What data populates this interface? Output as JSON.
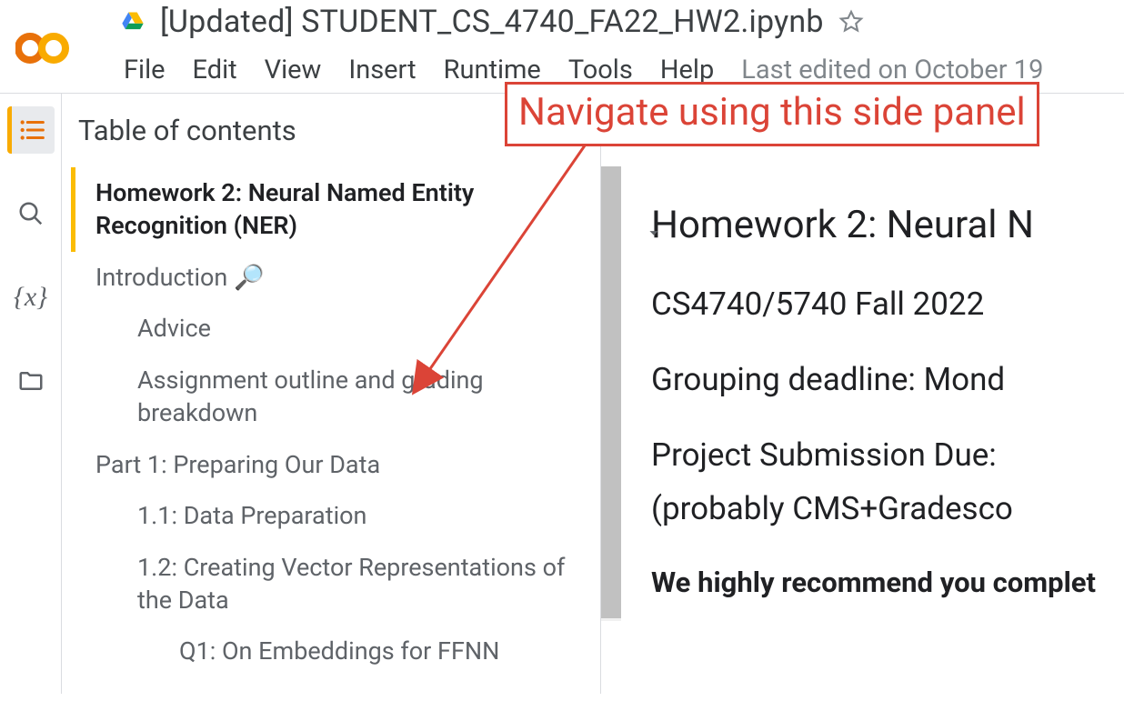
{
  "header": {
    "title": "[Updated] STUDENT_CS_4740_FA22_HW2.ipynb",
    "menu": [
      "File",
      "Edit",
      "View",
      "Insert",
      "Runtime",
      "Tools",
      "Help"
    ],
    "last_edited": "Last edited on October 19"
  },
  "toc": {
    "title": "Table of contents",
    "items": [
      {
        "label": "Homework 2: Neural Named Entity Recognition (NER)",
        "indent": 1,
        "active": true
      },
      {
        "label": "Introduction 🔎",
        "indent": 1
      },
      {
        "label": "Advice",
        "indent": 2
      },
      {
        "label": "Assignment outline and grading breakdown",
        "indent": 2
      },
      {
        "label": "Part 1: Preparing Our Data",
        "indent": 1
      },
      {
        "label": "1.1: Data Preparation",
        "indent": 2
      },
      {
        "label": "1.2: Creating Vector Representations of the Data",
        "indent": 2
      },
      {
        "label": "Q1: On Embeddings for FFNN",
        "indent": 3
      }
    ]
  },
  "notebook": {
    "heading": "Homework 2: Neural N",
    "line1": "CS4740/5740 Fall 2022",
    "line2": "Grouping deadline: Mond",
    "line3": "Project Submission Due:",
    "line4": "(probably CMS+Gradesco",
    "bold": "We highly recommend you complet"
  },
  "annotation": {
    "text": "Navigate using this side panel"
  },
  "colors": {
    "accent_orange": "#e8710a",
    "annotation_red": "#db4437"
  }
}
